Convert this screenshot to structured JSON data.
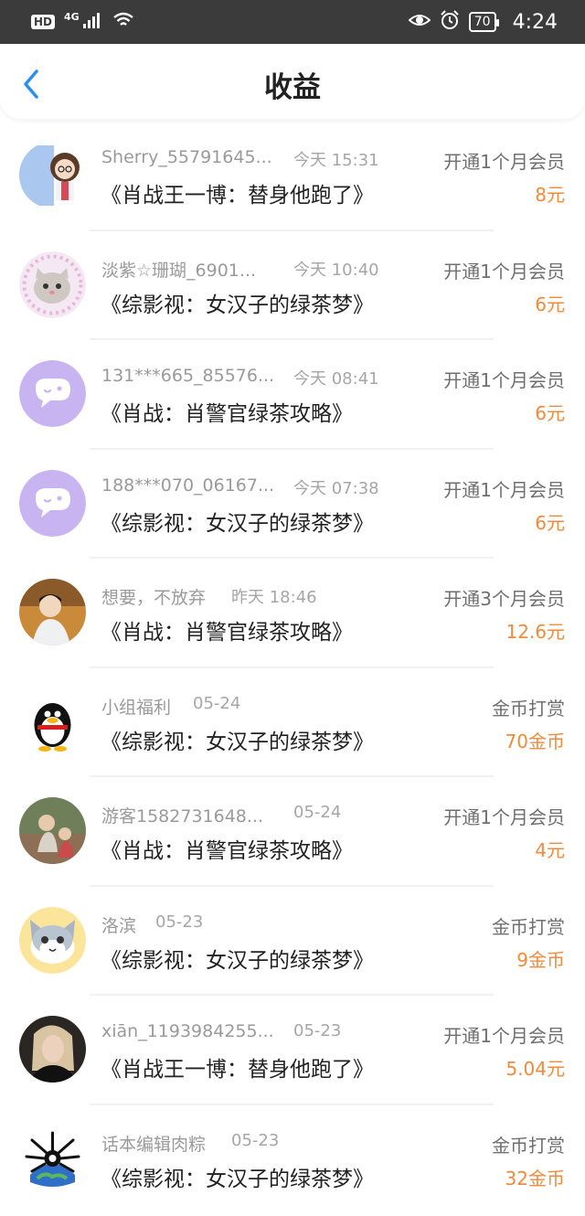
{
  "status_bar": {
    "hd": "HD",
    "network": "4G",
    "battery": "70",
    "time": "4:24"
  },
  "header": {
    "title": "收益"
  },
  "colors": {
    "amount": "#f08a3c",
    "back_arrow": "#2b8ef1",
    "status_bar_bg": "#3b3b3b"
  },
  "items": [
    {
      "name": "Sherry_55791645...",
      "time": "今天 15:31",
      "title": "《肖战王一博：替身他跑了》",
      "type": "开通1个月会员",
      "amount": "8元",
      "avatar": "female-cartoon-avatar"
    },
    {
      "name": "淡紫☆珊瑚_6901...",
      "time": "今天 10:40",
      "title": "《综影视：女汉子的绿茶梦》",
      "type": "开通1个月会员",
      "amount": "6元",
      "avatar": "cat-cartoon-avatar"
    },
    {
      "name": "131***665_85576...",
      "time": "今天 08:41",
      "title": "《肖战：肖警官绿茶攻略》",
      "type": "开通1个月会员",
      "amount": "6元",
      "avatar": "default-chat-avatar"
    },
    {
      "name": "188***070_06167...",
      "time": "今天 07:38",
      "title": "《综影视：女汉子的绿茶梦》",
      "type": "开通1个月会员",
      "amount": "6元",
      "avatar": "default-chat-avatar"
    },
    {
      "name": "想要，不放弃",
      "time": "昨天 18:46",
      "title": "《肖战：肖警官绿茶攻略》",
      "type": "开通3个月会员",
      "amount": "12.6元",
      "avatar": "photo-avatar"
    },
    {
      "name": "小组福利",
      "time": "05-24",
      "title": "《综影视：女汉子的绿茶梦》",
      "type": "金币打赏",
      "amount": "70金币",
      "avatar": "penguin-avatar"
    },
    {
      "name": "游客1582731648...",
      "time": "05-24",
      "title": "《肖战：肖警官绿茶攻略》",
      "type": "开通1个月会员",
      "amount": "4元",
      "avatar": "photo-avatar"
    },
    {
      "name": "洛滨",
      "time": "05-23",
      "title": "《综影视：女汉子的绿茶梦》",
      "type": "金币打赏",
      "amount": "9金币",
      "avatar": "cat-cartoon-avatar"
    },
    {
      "name": "xiān_1193984255...",
      "time": "05-23",
      "title": "《肖战王一博：替身他跑了》",
      "type": "开通1个月会员",
      "amount": "5.04元",
      "avatar": "photo-avatar"
    },
    {
      "name": "话本编辑肉粽",
      "time": "05-23",
      "title": "《综影视：女汉子的绿茶梦》",
      "type": "金币打赏",
      "amount": "32金币",
      "avatar": "globe-avatar"
    }
  ]
}
